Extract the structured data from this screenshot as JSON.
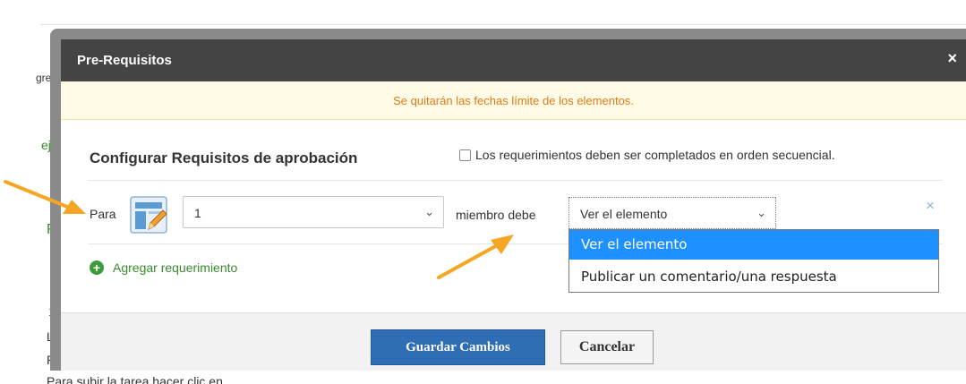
{
  "background": {
    "fragments": [
      "gre",
      "ej",
      "R",
      "1",
      "La",
      "Pu"
    ],
    "bottom_text": "Para subir la tarea hacer clic en"
  },
  "modal": {
    "title": "Pre-Requisitos",
    "close_label": "×",
    "warning": "Se quitarán las fechas límite de los elementos.",
    "config_title": "Configurar Requisitos de aprobación",
    "sequential_label": "Los requerimientos deben ser completados en orden secuencial.",
    "sequential_checked": false,
    "row": {
      "para_label": "Para",
      "item_icon": "document-edit-icon",
      "quantity_value": "1",
      "miembro_label": "miembro debe",
      "action_value": "Ver el elemento",
      "remove_label": "×"
    },
    "add_requirement_label": "Agregar requerimiento",
    "save_label": "Guardar Cambios",
    "cancel_label": "Cancelar"
  },
  "dropdown": {
    "options": [
      "Ver el elemento",
      "Publicar un comentario/una respuesta"
    ],
    "selected_index": 0
  },
  "colors": {
    "header_bg": "#444444",
    "warning_bg": "#fffbe6",
    "warning_text": "#e07b16",
    "primary_button": "#2f6db5",
    "highlight": "#1e90ff",
    "arrow": "#f5a623",
    "link_green": "#3b8a2f"
  }
}
